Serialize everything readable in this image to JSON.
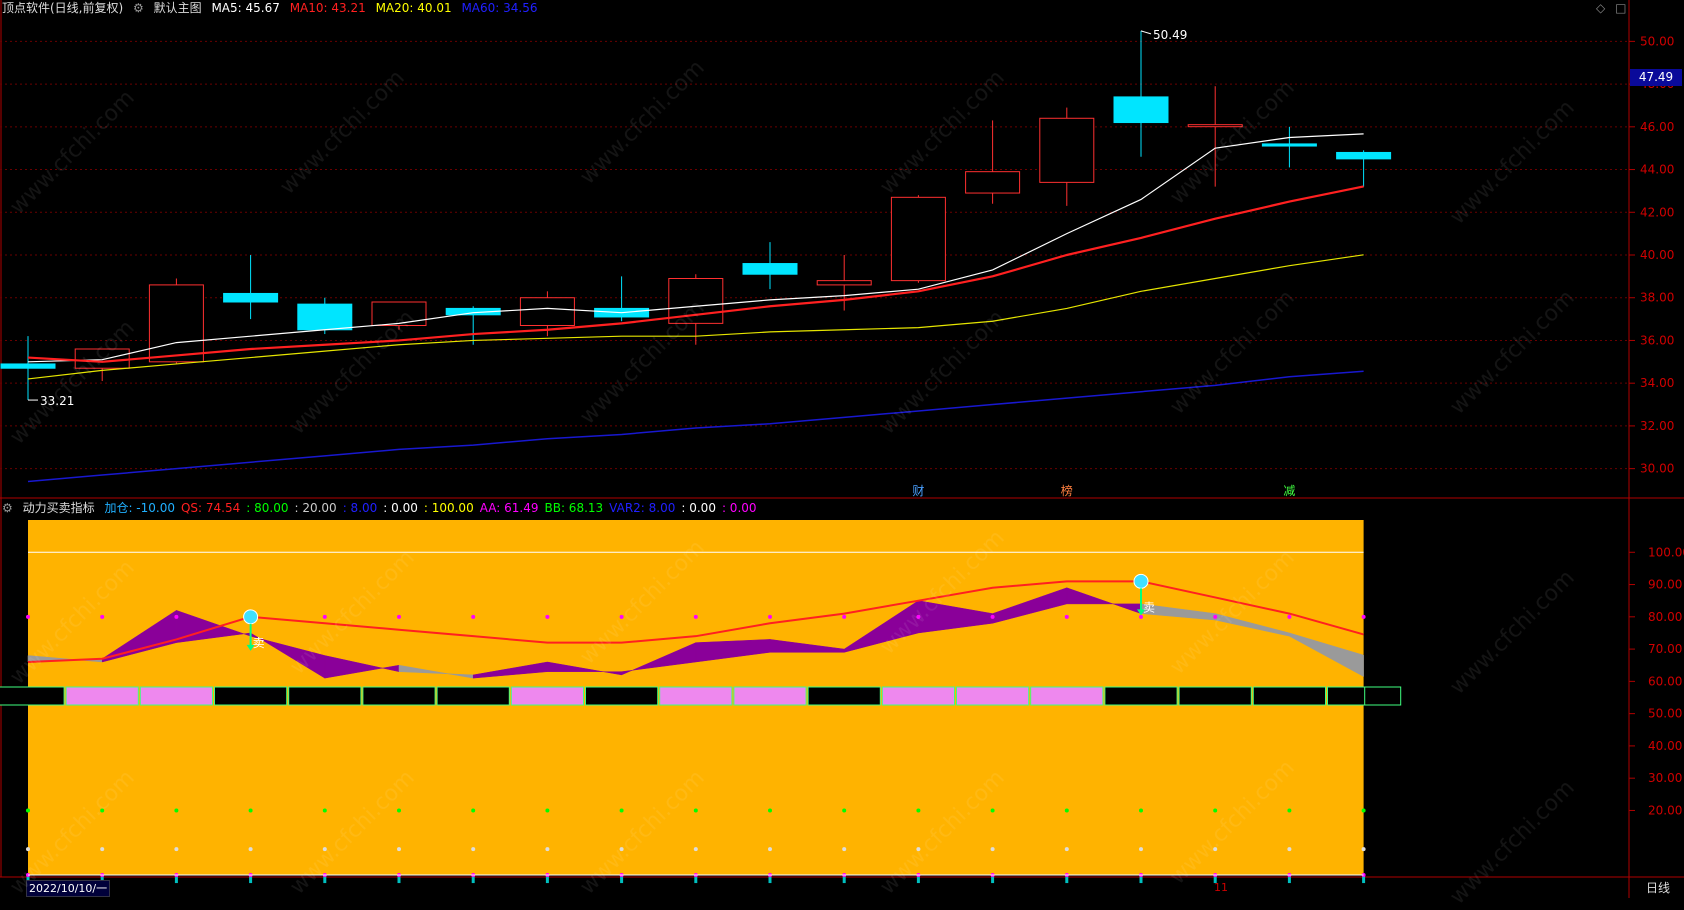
{
  "main_header": {
    "title": "顶点软件(日线,前复权)",
    "chart_name": "默认主图",
    "ma5": "MA5: 45.67",
    "ma10": "MA10: 43.21",
    "ma20": "MA20: 40.01",
    "ma60": "MA60: 34.56",
    "top_right_icons": [
      "◇",
      "□"
    ]
  },
  "sub_header": {
    "title": "动力买卖指标",
    "items": [
      {
        "text": "加仓: -10.00",
        "color": "#20b0ff"
      },
      {
        "text": "QS: 74.54",
        "color": "#ff2020"
      },
      {
        "text": ": 80.00",
        "color": "#00ff00"
      },
      {
        "text": ": 20.00",
        "color": "#cccccc"
      },
      {
        "text": ": 8.00",
        "color": "#2020ff"
      },
      {
        "text": ": 0.00",
        "color": "#ffffff"
      },
      {
        "text": ": 100.00",
        "color": "#ffff00"
      },
      {
        "text": "AA: 61.49",
        "color": "#ff00ff"
      },
      {
        "text": "BB: 68.13",
        "color": "#00ff00"
      },
      {
        "text": "VAR2: 8.00",
        "color": "#2020ff"
      },
      {
        "text": ": 0.00",
        "color": "#ffffff"
      },
      {
        "text": ": 0.00",
        "color": "#ff00ff"
      }
    ]
  },
  "price_axis": [
    "50.00",
    "48.00",
    "46.00",
    "44.00",
    "42.00",
    "40.00",
    "38.00",
    "36.00",
    "34.00",
    "32.00",
    "30.00"
  ],
  "current_price": "47.49",
  "high_label": "50.49",
  "low_label": "33.21",
  "event_markers": [
    {
      "text": "财",
      "color": "#4aa0ff"
    },
    {
      "text": "榜",
      "color": "#ff8040"
    },
    {
      "text": "减",
      "color": "#40ff40"
    }
  ],
  "indicator_axis": [
    "100.00",
    "90.00",
    "80.00",
    "70.00",
    "60.00",
    "50.00",
    "40.00",
    "30.00",
    "20.00"
  ],
  "sell_labels": [
    "卖",
    "卖"
  ],
  "bottom_date": "2022/10/10/一",
  "bottom_mark": "11",
  "period": "日线",
  "watermark": "www.cfchi.com",
  "colors": {
    "up": "#ff3030",
    "down": "#00e5ff",
    "ma5": "#ffffff",
    "ma10": "#ff2020",
    "ma20": "#e5e500",
    "ma60": "#1818d0",
    "indicator_bg": "#ffb300"
  },
  "chart_data": [
    {
      "type": "candlestick",
      "title": "默认主图",
      "ylim": [
        29,
        51
      ],
      "candles": [
        {
          "o": 34.9,
          "h": 36.2,
          "l": 33.21,
          "c": 34.7
        },
        {
          "o": 34.7,
          "h": 35.6,
          "l": 34.1,
          "c": 35.6
        },
        {
          "o": 35.0,
          "h": 38.9,
          "l": 34.9,
          "c": 38.6
        },
        {
          "o": 38.2,
          "h": 40.0,
          "l": 37.0,
          "c": 37.8
        },
        {
          "o": 37.7,
          "h": 38.0,
          "l": 36.3,
          "c": 36.5
        },
        {
          "o": 36.7,
          "h": 37.8,
          "l": 36.5,
          "c": 37.8
        },
        {
          "o": 37.5,
          "h": 37.6,
          "l": 35.8,
          "c": 37.2
        },
        {
          "o": 36.7,
          "h": 38.3,
          "l": 36.2,
          "c": 38.0
        },
        {
          "o": 37.5,
          "h": 39.0,
          "l": 36.9,
          "c": 37.1
        },
        {
          "o": 36.8,
          "h": 39.1,
          "l": 35.8,
          "c": 38.9
        },
        {
          "o": 39.6,
          "h": 40.6,
          "l": 38.4,
          "c": 39.1
        },
        {
          "o": 38.6,
          "h": 40.0,
          "l": 37.4,
          "c": 38.8
        },
        {
          "o": 38.8,
          "h": 42.8,
          "l": 38.7,
          "c": 42.7
        },
        {
          "o": 42.9,
          "h": 46.3,
          "l": 42.4,
          "c": 43.9
        },
        {
          "o": 43.4,
          "h": 46.9,
          "l": 42.3,
          "c": 46.4
        },
        {
          "o": 47.4,
          "h": 50.49,
          "l": 44.6,
          "c": 46.2
        },
        {
          "o": 46.1,
          "h": 47.9,
          "l": 43.2,
          "c": 46.1
        },
        {
          "o": 45.2,
          "h": 46.0,
          "l": 44.1,
          "c": 45.1
        },
        {
          "o": 44.8,
          "h": 44.9,
          "l": 43.2,
          "c": 44.5
        }
      ],
      "series": [
        {
          "name": "MA5",
          "values": [
            35.0,
            35.1,
            35.9,
            36.2,
            36.5,
            36.8,
            37.3,
            37.5,
            37.3,
            37.6,
            37.9,
            38.1,
            38.4,
            39.3,
            41.0,
            42.6,
            45.0,
            45.5,
            45.67
          ]
        },
        {
          "name": "MA10",
          "values": [
            35.2,
            35.0,
            35.3,
            35.6,
            35.8,
            36.0,
            36.3,
            36.5,
            36.8,
            37.2,
            37.6,
            37.9,
            38.3,
            39.0,
            40.0,
            40.8,
            41.7,
            42.5,
            43.21
          ]
        },
        {
          "name": "MA20",
          "values": [
            34.2,
            34.6,
            34.9,
            35.2,
            35.5,
            35.8,
            36.0,
            36.1,
            36.2,
            36.2,
            36.4,
            36.5,
            36.6,
            36.9,
            37.5,
            38.3,
            38.9,
            39.5,
            40.01
          ]
        },
        {
          "name": "MA60",
          "values": [
            29.4,
            29.7,
            30.0,
            30.3,
            30.6,
            30.9,
            31.1,
            31.4,
            31.6,
            31.9,
            32.1,
            32.4,
            32.7,
            33.0,
            33.3,
            33.6,
            33.9,
            34.3,
            34.56
          ]
        }
      ]
    },
    {
      "type": "area",
      "title": "动力买卖指标",
      "ylim": [
        0,
        110
      ],
      "series": [
        {
          "name": "QS",
          "values": [
            66,
            67,
            73,
            80,
            78,
            76,
            74,
            72,
            72,
            74,
            78,
            81,
            85,
            89,
            91,
            91,
            86,
            81,
            74.54
          ]
        },
        {
          "name": "AA",
          "values": [
            66,
            67,
            82,
            74,
            68,
            63,
            62,
            66,
            62,
            72,
            73,
            70,
            85,
            81,
            89,
            81,
            79,
            74,
            61.49
          ]
        },
        {
          "name": "BB",
          "values": [
            68,
            66,
            72,
            75,
            61,
            65,
            61,
            63,
            63,
            66,
            69,
            69,
            75,
            78,
            84,
            84,
            81,
            75,
            68.13
          ]
        }
      ],
      "state_blocks": [
        "off",
        "on",
        "on",
        "off",
        "off",
        "off",
        "off",
        "on",
        "off",
        "on",
        "on",
        "off",
        "on",
        "on",
        "on",
        "off",
        "off",
        "off",
        "off"
      ],
      "sell_signals": [
        3,
        15
      ]
    }
  ]
}
